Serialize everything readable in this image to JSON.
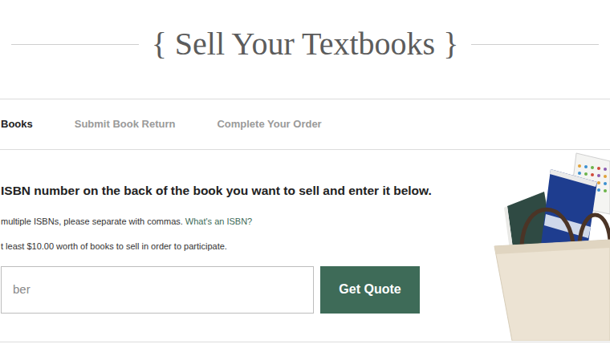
{
  "title": "{ Sell Your Textbooks }",
  "steps": [
    {
      "label": "Books",
      "selected": true
    },
    {
      "label": "Submit Book Return",
      "selected": false
    },
    {
      "label": "Complete Your Order",
      "selected": false
    }
  ],
  "instruction": "ISBN number on the back of the book you want to sell and enter it below.",
  "notes": [
    {
      "text": "multiple ISBNs, please separate with commas.",
      "link": "What's an ISBN?"
    },
    {
      "text": "t least $10.00 worth of books to sell in order to participate.",
      "link": ""
    }
  ],
  "search": {
    "placeholder": "ber"
  },
  "button": "Get Quote"
}
